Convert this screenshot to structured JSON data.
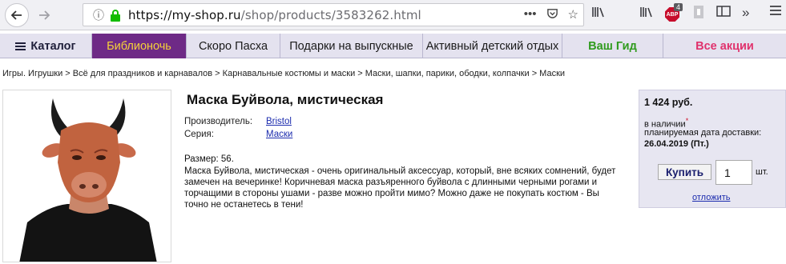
{
  "browser": {
    "url_host": "https://my-shop.ru",
    "url_path": "/shop/products/3583262.html",
    "abp_label": "ABP",
    "abp_badge": "4"
  },
  "nav": {
    "items": [
      {
        "label": "Каталог"
      },
      {
        "label": "Библионочь"
      },
      {
        "label": "Скоро Пасха"
      },
      {
        "label": "Подарки на выпускные"
      },
      {
        "label": "Активный детский отдых"
      },
      {
        "label": "Ваш Гид"
      },
      {
        "label": "Все акции"
      }
    ]
  },
  "breadcrumb": "Игры. Игрушки > Всё для праздников и карнавалов > Карнавальные костюмы и маски > Маски, шапки, парики, ободки, колпачки > Маски",
  "product": {
    "title": "Маска Буйвола, мистическая",
    "manufacturer_label": "Производитель:",
    "manufacturer": "Bristol",
    "series_label": "Серия:",
    "series": "Маски",
    "size": "Размер: 56.",
    "description": "Маска Буйвола, мистическая - очень оригинальный аксессуар, который, вне всяких сомнений, будет замечен на вечеринке! Коричневая маска разъяренного буйвола с длинными черными рогами и торчащими в стороны ушами - разве можно пройти мимо? Можно даже не покупать костюм - Вы точно не останетесь в тени!"
  },
  "buybox": {
    "price": "1 424 руб.",
    "stock": "в наличии",
    "stock_mark": "*",
    "delivery_label": "планируемая дата доставки:",
    "delivery_date": "26.04.2019 (Пт.)",
    "buy_label": "Купить",
    "qty": "1",
    "unit": "шт.",
    "postpone": "отложить"
  },
  "colors": {
    "nav_bg": "#e4e2ef",
    "biblio_bg": "#6e2a86",
    "biblio_text": "#f4d13a",
    "guide": "#2f9b1d",
    "sales": "#e0326d",
    "link": "#1c2cae",
    "buybox_bg": "#e7e6f1"
  }
}
